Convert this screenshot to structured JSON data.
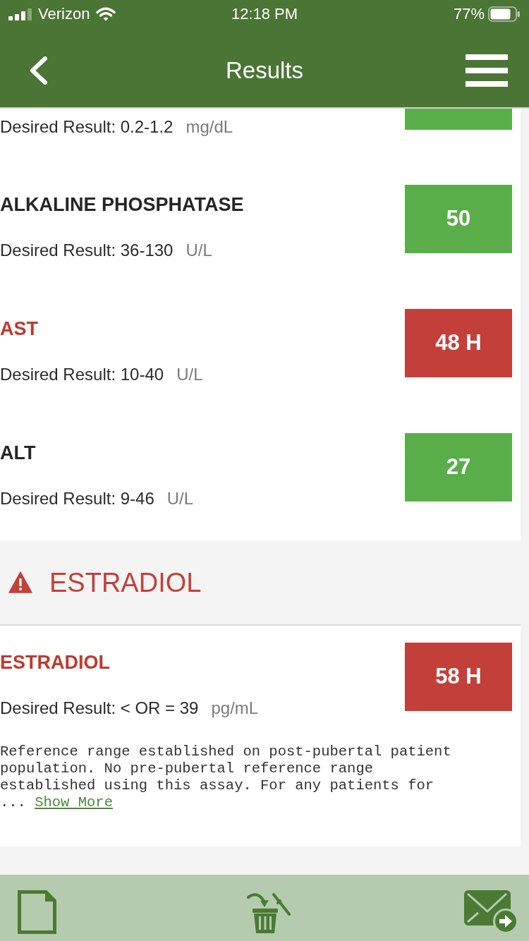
{
  "status_bar": {
    "carrier": "Verizon",
    "time": "12:18 PM",
    "battery": "77%"
  },
  "nav": {
    "title": "Results"
  },
  "items": [
    {
      "kind": "result",
      "out_of_range": false,
      "desired": "Desired Result: 0.2-1.2",
      "unit": "mg/dL"
    },
    {
      "kind": "result",
      "out_of_range": false,
      "name": "ALKALINE PHOSPHATASE",
      "value": "50",
      "desired": "Desired Result: 36-130",
      "unit": "U/L"
    },
    {
      "kind": "result",
      "out_of_range": true,
      "name": "AST",
      "value": "48 H",
      "desired": "Desired Result: 10-40",
      "unit": "U/L"
    },
    {
      "kind": "result",
      "out_of_range": false,
      "name": "ALT",
      "value": "27",
      "desired": "Desired Result: 9-46",
      "unit": "U/L"
    },
    {
      "kind": "section",
      "alert": true,
      "title": "ESTRADIOL"
    },
    {
      "kind": "result",
      "out_of_range": true,
      "name": "ESTRADIOL",
      "value": "58 H",
      "desired": "Desired Result: < OR = 39",
      "unit": "pg/mL",
      "note": "Reference range established on post-pubertal patient population. No pre-pubertal reference range established using this assay. For any patients for ...",
      "more_link": "Show More"
    }
  ]
}
